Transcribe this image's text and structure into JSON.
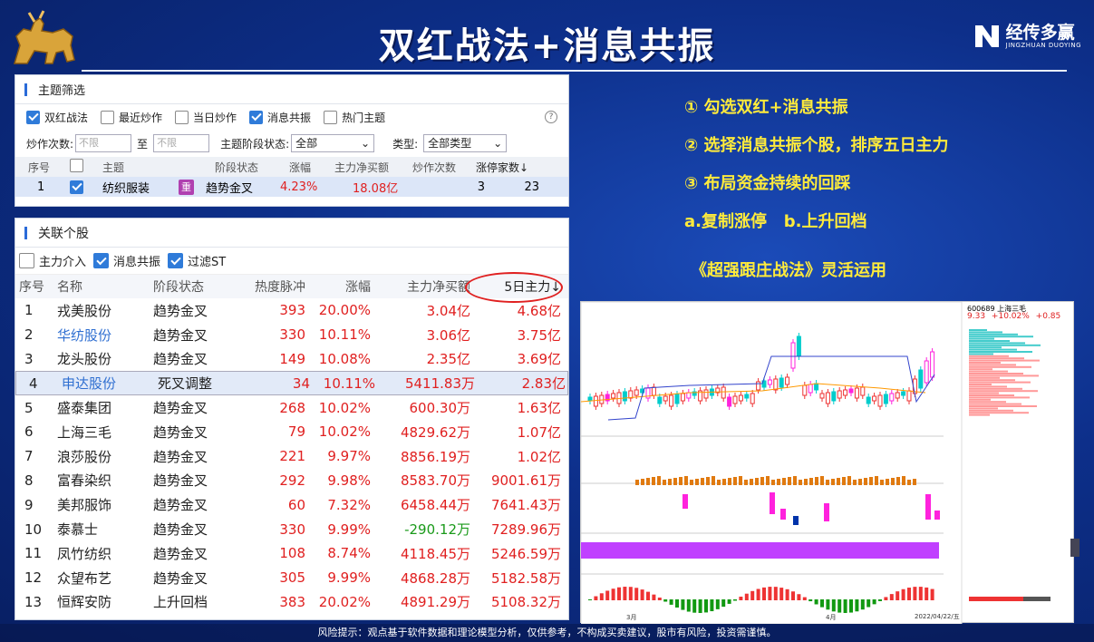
{
  "title": "双红战法+消息共振",
  "logo": {
    "name": "经传多赢",
    "sub": "JINGZHUAN DUOYING"
  },
  "panel1": {
    "title": "主题筛选",
    "checkboxes": [
      {
        "label": "双红战法",
        "checked": true
      },
      {
        "label": "最近炒作",
        "checked": false
      },
      {
        "label": "当日炒作",
        "checked": false
      },
      {
        "label": "消息共振",
        "checked": true
      },
      {
        "label": "热门主题",
        "checked": false
      }
    ],
    "help": "?",
    "count_label": "炒作次数:",
    "count_from_placeholder": "不限",
    "to_label": "至",
    "count_to_placeholder": "不限",
    "stage_label": "主题阶段状态:",
    "stage_value": "全部",
    "type_label": "类型:",
    "type_value": "全部类型",
    "columns": [
      "序号",
      "",
      "主题",
      "阶段状态",
      "涨幅",
      "主力净买额",
      "炒作次数",
      "涨停家数↓"
    ],
    "row": {
      "idx": "1",
      "theme": "纺织服装",
      "badge": "重",
      "stage": "趋势金叉",
      "change": "4.23%",
      "net": "18.08亿",
      "times": "3",
      "limit": "23"
    }
  },
  "panel2": {
    "title": "关联个股",
    "checkboxes": [
      {
        "label": "主力介入",
        "checked": false
      },
      {
        "label": "消息共振",
        "checked": true
      },
      {
        "label": "过滤ST",
        "checked": true
      }
    ],
    "columns": [
      "序号",
      "名称",
      "阶段状态",
      "热度脉冲",
      "涨幅",
      "主力净买额",
      "5日主力↓"
    ],
    "rows": [
      {
        "idx": "1",
        "name": "戎美股份",
        "stage": "趋势金叉",
        "heat": "393",
        "change": "20.00%",
        "net": "3.04亿",
        "five": "4.68亿"
      },
      {
        "idx": "2",
        "name": "华纺股份",
        "stage": "趋势金叉",
        "heat": "330",
        "change": "10.11%",
        "net": "3.06亿",
        "five": "3.75亿"
      },
      {
        "idx": "3",
        "name": "龙头股份",
        "stage": "趋势金叉",
        "heat": "149",
        "change": "10.08%",
        "net": "2.35亿",
        "five": "3.69亿"
      },
      {
        "idx": "4",
        "name": "申达股份",
        "stage": "死叉调整",
        "heat": "34",
        "change": "10.11%",
        "net": "5411.83万",
        "five": "2.83亿"
      },
      {
        "idx": "5",
        "name": "盛泰集团",
        "stage": "趋势金叉",
        "heat": "268",
        "change": "10.02%",
        "net": "600.30万",
        "five": "1.63亿"
      },
      {
        "idx": "6",
        "name": "上海三毛",
        "stage": "趋势金叉",
        "heat": "79",
        "change": "10.02%",
        "net": "4829.62万",
        "five": "1.07亿"
      },
      {
        "idx": "7",
        "name": "浪莎股份",
        "stage": "趋势金叉",
        "heat": "221",
        "change": "9.97%",
        "net": "8856.19万",
        "five": "1.02亿"
      },
      {
        "idx": "8",
        "name": "富春染织",
        "stage": "趋势金叉",
        "heat": "292",
        "change": "9.98%",
        "net": "8583.70万",
        "five": "9001.61万"
      },
      {
        "idx": "9",
        "name": "美邦服饰",
        "stage": "趋势金叉",
        "heat": "60",
        "change": "7.32%",
        "net": "6458.44万",
        "five": "7641.43万"
      },
      {
        "idx": "10",
        "name": "泰慕士",
        "stage": "趋势金叉",
        "heat": "330",
        "change": "9.99%",
        "net": "-290.12万",
        "five": "7289.96万"
      },
      {
        "idx": "11",
        "name": "凤竹纺织",
        "stage": "趋势金叉",
        "heat": "108",
        "change": "8.74%",
        "net": "4118.45万",
        "five": "5246.59万"
      },
      {
        "idx": "12",
        "name": "众望布艺",
        "stage": "趋势金叉",
        "heat": "305",
        "change": "9.99%",
        "net": "4868.28万",
        "five": "5182.58万"
      },
      {
        "idx": "13",
        "name": "恒辉安防",
        "stage": "上升回档",
        "heat": "383",
        "change": "20.02%",
        "net": "4891.29万",
        "five": "5108.32万"
      }
    ]
  },
  "steps": [
    "① 勾选双红+消息共振",
    "② 选择消息共振个股，排序五日主力",
    "③ 布局资金持续的回踩",
    "a.复制涨停   b.上升回档"
  ],
  "tagline": "《超强跟庄战法》灵活运用",
  "chart_panel": {
    "code": "600689 上海三毛",
    "price": "9.33",
    "change": "+10.02%",
    "delta": "+0.85",
    "date": "2022/04/22/五",
    "x_labels": [
      "3月",
      "4月"
    ]
  },
  "footer": "风险提示：观点基于软件数据和理论模型分析，仅供参考，不构成买卖建议，股市有风险，投资需谨慎。"
}
